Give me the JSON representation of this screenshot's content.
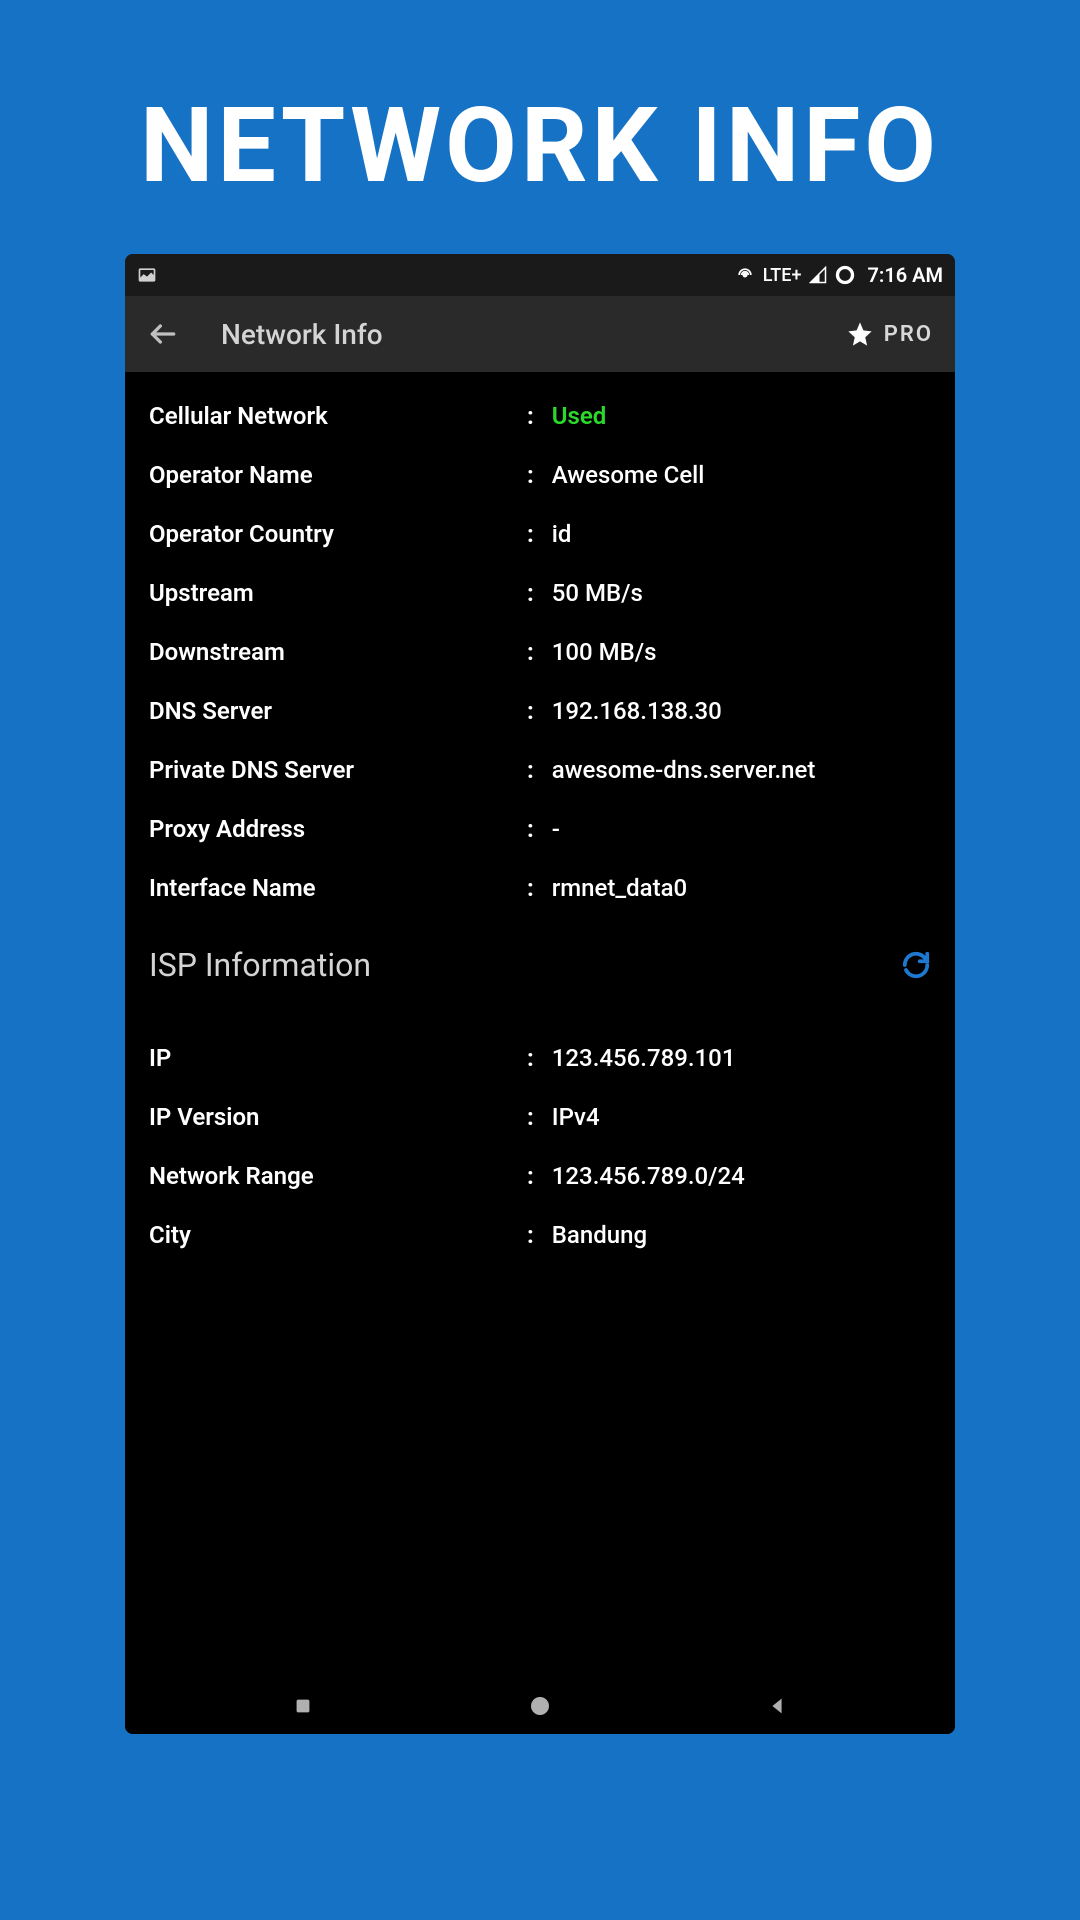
{
  "promo": {
    "title": "NETWORK INFO"
  },
  "status": {
    "lte": "LTE+",
    "time": "7:16 AM"
  },
  "appbar": {
    "title": "Network Info",
    "pro": "PRO"
  },
  "rows": [
    {
      "label": "Cellular Network",
      "value": "Used",
      "green": true
    },
    {
      "label": "Operator Name",
      "value": "Awesome Cell"
    },
    {
      "label": "Operator Country",
      "value": "id"
    },
    {
      "label": "Upstream",
      "value": "50 MB/s"
    },
    {
      "label": "Downstream",
      "value": "100 MB/s"
    },
    {
      "label": "DNS Server",
      "value": "192.168.138.30"
    },
    {
      "label": "Private DNS Server",
      "value": "awesome-dns.server.net"
    },
    {
      "label": "Proxy Address",
      "value": "-"
    },
    {
      "label": "Interface Name",
      "value": "rmnet_data0"
    }
  ],
  "section": {
    "title": "ISP Information"
  },
  "isp_rows": [
    {
      "label": "IP",
      "value": "123.456.789.101"
    },
    {
      "label": "IP Version",
      "value": "IPv4"
    },
    {
      "label": "Network Range",
      "value": "123.456.789.0/24"
    },
    {
      "label": "City",
      "value": "Bandung"
    }
  ]
}
